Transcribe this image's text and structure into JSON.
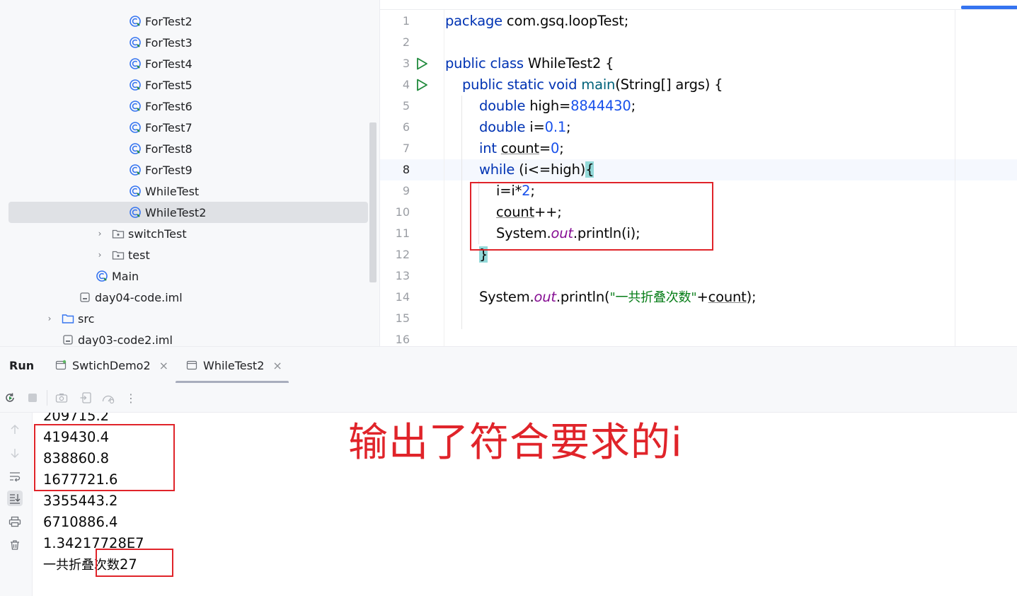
{
  "project_tree": {
    "items": [
      {
        "label": "ForTest2",
        "kind": "class"
      },
      {
        "label": "ForTest3",
        "kind": "class"
      },
      {
        "label": "ForTest4",
        "kind": "class"
      },
      {
        "label": "ForTest5",
        "kind": "class"
      },
      {
        "label": "ForTest6",
        "kind": "class"
      },
      {
        "label": "ForTest7",
        "kind": "class"
      },
      {
        "label": "ForTest8",
        "kind": "class"
      },
      {
        "label": "ForTest9",
        "kind": "class"
      },
      {
        "label": "WhileTest",
        "kind": "class"
      },
      {
        "label": "WhileTest2",
        "kind": "class",
        "selected": true
      },
      {
        "label": "switchTest",
        "kind": "package",
        "collapsed": true
      },
      {
        "label": "test",
        "kind": "package",
        "collapsed": true
      },
      {
        "label": "Main",
        "kind": "class"
      },
      {
        "label": "day04-code.iml",
        "kind": "iml-file"
      },
      {
        "label": "src",
        "kind": "folder",
        "collapsed": true
      },
      {
        "label": "day03-code2.iml",
        "kind": "iml-file"
      }
    ]
  },
  "editor": {
    "line_numbers": [
      "1",
      "2",
      "3",
      "4",
      "5",
      "6",
      "7",
      "8",
      "9",
      "10",
      "11",
      "12",
      "13",
      "14",
      "15",
      "16"
    ],
    "current_line": "8",
    "run_gutter_lines": [
      "3",
      "4"
    ],
    "code": {
      "l1_kw": "package",
      "l1_rest": " com.gsq.loopTest;",
      "l3_kw": "public class",
      "l3_rest": " WhileTest2 {",
      "l4_kw": "public static void",
      "l4_fn": "main",
      "l4_rest": "(String[] args) {",
      "l5_kw": "double",
      "l5_mid": " high=",
      "l5_num": "8844430",
      "l5_end": ";",
      "l6_kw": "double",
      "l6_mid": " i=",
      "l6_num": "0.1",
      "l6_end": ";",
      "l7_kw": "int",
      "l7_sp": " ",
      "l7_var": "count",
      "l7_mid": "=",
      "l7_num": "0",
      "l7_end": ";",
      "l8_kw": "while",
      "l8_rest": " (i<=high)",
      "l8_brace": "{",
      "l9_a": "i=i*",
      "l9_num": "2",
      "l9_end": ";",
      "l10_var": "count",
      "l10_end": "++;",
      "l11_a": "System.",
      "l11_fld": "out",
      "l11_b": ".println(i);",
      "l12_brace": "}",
      "l14_a": "System.",
      "l14_fld": "out",
      "l14_b": ".println(",
      "l14_str": "\"一共折叠次数\"",
      "l14_c": "+",
      "l14_var": "count",
      "l14_d": ");"
    }
  },
  "run_panel": {
    "title": "Run",
    "tabs": [
      {
        "label": "SwtichDemo2",
        "close": "×"
      },
      {
        "label": "WhileTest2",
        "close": "×",
        "active": true
      }
    ],
    "toolbar_icons": [
      "rerun-icon",
      "stop-icon",
      "screenshot-icon",
      "restore-layout-icon",
      "profiler-icon",
      "more-icon"
    ],
    "more_glyph": "⋮",
    "side_icons": [
      "up-arrow-icon",
      "down-arrow-icon",
      "soft-wrap-icon",
      "scroll-to-end-icon",
      "print-icon",
      "trash-icon"
    ],
    "output_lines": [
      "209715.2",
      "419430.4",
      "838860.8",
      "1677721.6",
      "3355443.2",
      "6710886.4",
      "1.34217728E7"
    ],
    "final_line_prefix": "一共折叠次数",
    "final_line_value": "27"
  },
  "annotation": {
    "text": "输出了符合要求的i",
    "color": "#e0242a"
  },
  "colors": {
    "accent": "#3574f0",
    "keyword": "#0033b3",
    "number": "#1750eb",
    "string": "#067d17",
    "field": "#871094",
    "run_green": "#208a3c",
    "annotation_red": "#e0242a"
  }
}
